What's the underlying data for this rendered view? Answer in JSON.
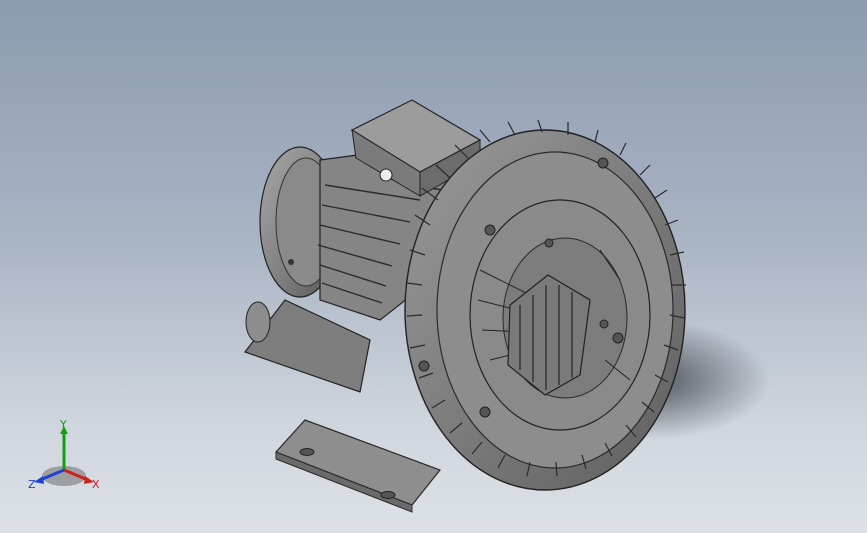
{
  "viewport": {
    "background_top": "#8c9bb0",
    "background_bottom": "#dde1e7",
    "model_shade": "#7a7a7a"
  },
  "triad": {
    "x_label": "X",
    "y_label": "Y",
    "z_label": "Z",
    "x_color": "#d02020",
    "y_color": "#10a010",
    "z_color": "#2040d0"
  }
}
